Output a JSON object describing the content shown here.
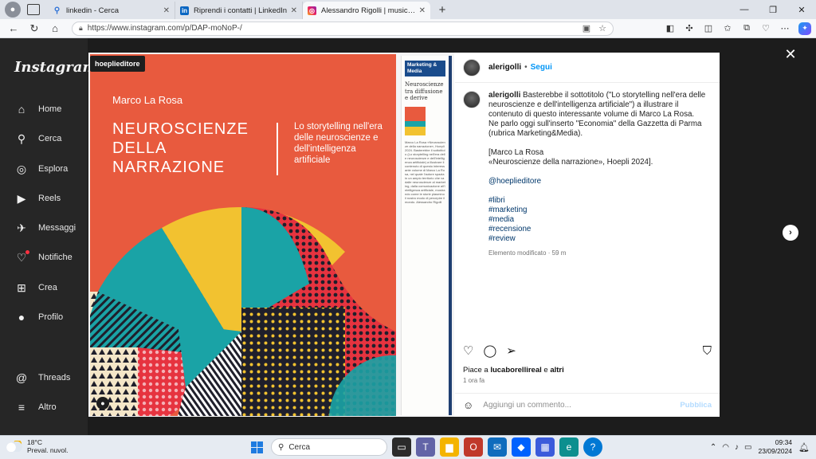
{
  "browser": {
    "tabs": [
      {
        "label": "linkedin - Cerca",
        "icon": "search-icon",
        "active": false
      },
      {
        "label": "Riprendi i contatti | LinkedIn",
        "icon": "linkedin-icon",
        "active": false
      },
      {
        "label": "Alessandro Rigolli | musica e cor",
        "icon": "instagram-icon",
        "active": true
      }
    ],
    "url": "https://www.instagram.com/p/DAP-moNoP-/"
  },
  "instagram": {
    "logo": "Instagram",
    "nav": [
      {
        "label": "Home",
        "icon": "home-icon",
        "glyph": "⌂"
      },
      {
        "label": "Cerca",
        "icon": "search-icon",
        "glyph": "⚲"
      },
      {
        "label": "Esplora",
        "icon": "compass-icon",
        "glyph": "◎"
      },
      {
        "label": "Reels",
        "icon": "reels-icon",
        "glyph": "▶"
      },
      {
        "label": "Messaggi",
        "icon": "messenger-icon",
        "glyph": "✈"
      },
      {
        "label": "Notifiche",
        "icon": "heart-icon",
        "glyph": "♡"
      },
      {
        "label": "Crea",
        "icon": "plus-square-icon",
        "glyph": "⊞"
      },
      {
        "label": "Profilo",
        "icon": "profile-avatar-icon",
        "glyph": "●"
      }
    ],
    "nav_bottom": [
      {
        "label": "Threads",
        "icon": "threads-icon",
        "glyph": "@"
      },
      {
        "label": "Altro",
        "icon": "menu-icon",
        "glyph": "≡"
      }
    ]
  },
  "post": {
    "publisher_badge": "hoeplieditore",
    "cover": {
      "author": "Marco La Rosa",
      "title": "NEUROSCIENZE\nDELLA\nNARRAZIONE",
      "subtitle": "Lo storytelling nell'era delle neuroscienze e dell'intelligenza artificiale"
    },
    "clipping": {
      "header": "Marketing & Media",
      "title": "Neuroscienze tra diffusione e derive",
      "body": "Marco La Rosa «Neuroscienze della narrazione», Hoepli 2024. Basterebbe il sottotitolo (Lo storytelling nell'era delle neuroscienze e dell'intelligenza artificiale) a illustrare il contenuto di questo interessante volume di Marco La Rosa, nel quale l'autore spazia in un ampio territorio che va dalle neuroscienze al marketing, dalla comunicazione all'intelligenza artificiale, mostrando come le storie plasmino il nostro modo di percepire il mondo. Alessandro Rigolli"
    },
    "username": "alerigolli",
    "follow_label": "Segui",
    "caption_lines": [
      "Basterebbe il sottotitolo (\"Lo storytelling nell'era delle neuroscienze e dell'intelligenza artificiale\") a illustrare il contenuto di questo interessante volume di Marco La Rosa.",
      "Ne parlo oggi sull'inserto \"Economia\" della Gazzetta di Parma (rubrica Marketing&Media)."
    ],
    "citation": [
      "[Marco La Rosa",
      "«Neuroscienze della narrazione», Hoepli 2024]."
    ],
    "mention": "@hoeplieditore",
    "hashtags": [
      "#libri",
      "#marketing",
      "#media",
      "#recensione",
      "#review"
    ],
    "edited_label": "Elemento modificato · 59 m",
    "likes_prefix": "Piace a",
    "likes_user": "lucaborellireal",
    "likes_and": "e",
    "likes_others": "altri",
    "time_ago": "1 ora fa",
    "comment_placeholder": "Aggiungi un commento...",
    "publish_label": "Pubblica"
  },
  "taskbar": {
    "temperature": "18°C",
    "weather": "Preval. nuvol.",
    "search_label": "Cerca",
    "time": "09:34",
    "date": "23/09/2024"
  },
  "colors": {
    "cover_orange": "#e85a3e",
    "accent_blue": "#0095f6",
    "link_blue": "#00376b"
  }
}
